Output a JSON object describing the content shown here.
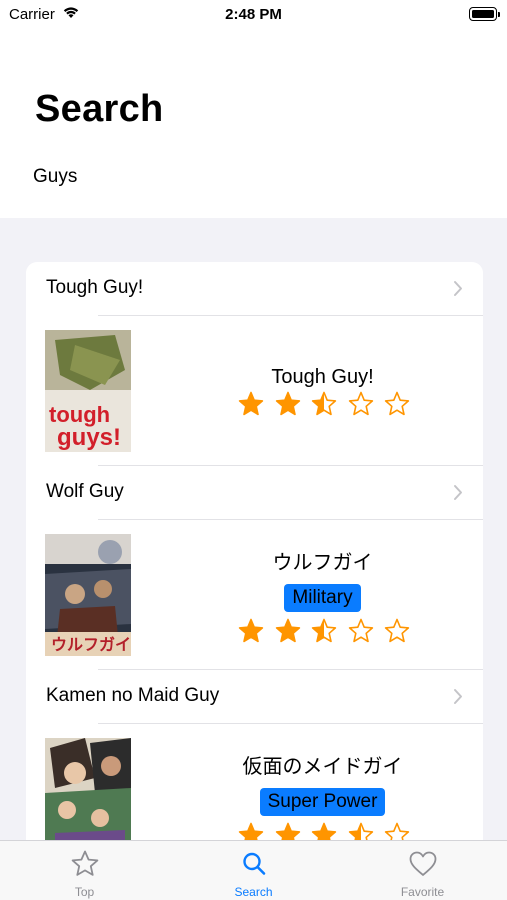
{
  "status_bar": {
    "carrier": "Carrier",
    "time": "2:48 PM"
  },
  "header": {
    "title": "Search",
    "query": "Guys"
  },
  "results": [
    {
      "name": "Tough Guy!",
      "display_title": "Tough Guy!",
      "tag": "",
      "rating": 2.5,
      "rating_max": 5,
      "poster_icon": "poster-image"
    },
    {
      "name": "Wolf Guy",
      "display_title": "ウルフガイ",
      "tag": "Military",
      "rating": 2.5,
      "rating_max": 5,
      "poster_icon": "poster-image"
    },
    {
      "name": "Kamen no Maid Guy",
      "display_title": "仮面のメイドガイ",
      "tag": "Super Power",
      "rating": 3.5,
      "rating_max": 5,
      "poster_icon": "poster-image"
    }
  ],
  "tabs": [
    {
      "label": "Top",
      "icon": "star-icon",
      "active": false
    },
    {
      "label": "Search",
      "icon": "search-icon",
      "active": true
    },
    {
      "label": "Favorite",
      "icon": "heart-icon",
      "active": false
    }
  ],
  "colors": {
    "accent": "#0a7cff",
    "star": "#ff9500",
    "inactive": "#8e8e93",
    "tag_bg": "#0a7cff"
  }
}
